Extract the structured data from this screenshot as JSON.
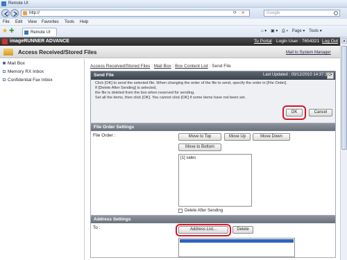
{
  "browser": {
    "window_title": "Remote UI",
    "url": "http://",
    "search_placeholder": "Google",
    "menu": [
      "File",
      "Edit",
      "View",
      "Favorites",
      "Tools",
      "Help"
    ],
    "tab_title": "Remote UI",
    "toolbar_right": [
      "Page",
      "Tools"
    ]
  },
  "app": {
    "product_name": "imageRUNNER ADVANCE",
    "to_portal": "To Portal",
    "login_user": "Login User : 7654321",
    "logout": "Log Out",
    "page_title": "Access Received/Stored Files",
    "mail_to_system_manager": "Mail to System Manager"
  },
  "sidebar": {
    "items": [
      {
        "label": "Mail Box",
        "active": true
      },
      {
        "label": "Memory RX Inbox",
        "active": false
      },
      {
        "label": "Confidential Fax Inbox",
        "active": false
      }
    ]
  },
  "breadcrumb": {
    "items": [
      "Access Received/Stored Files",
      "Mail Box",
      "Box Content List",
      "Send File"
    ],
    "separator": " : "
  },
  "send_file": {
    "title": "Send File",
    "last_updated": "Last Updated : 03/12/2010 14:37:31",
    "message_lines": [
      "Click [OK] to send the selected file. When changing the order of the file to send, specify the order in [File Order].",
      "If [Delete After Sending] is selected,",
      "the file is deleted from the box when reserved for sending.",
      "Set all the items, then click [OK]. You cannot click [OK] if some items have not been set."
    ],
    "ok_label": "OK",
    "cancel_label": "Cancel"
  },
  "file_order": {
    "section_title": "File Order Settings",
    "label": "File Order :",
    "buttons": [
      "Move to Top",
      "Move Up",
      "Move Down",
      "Move to Bottom"
    ],
    "files": [
      "[1] sales"
    ],
    "delete_after_sending_label": "Delete After Sending",
    "delete_after_sending_checked": false
  },
  "address": {
    "section_title": "Address Settings",
    "to_label": "To :",
    "address_list_label": "Address List...",
    "delete_label": "Delete"
  },
  "colors": {
    "highlight_ring": "#d6162a",
    "header_dark": "#2a2a2a",
    "selection": "#2f63c2"
  }
}
